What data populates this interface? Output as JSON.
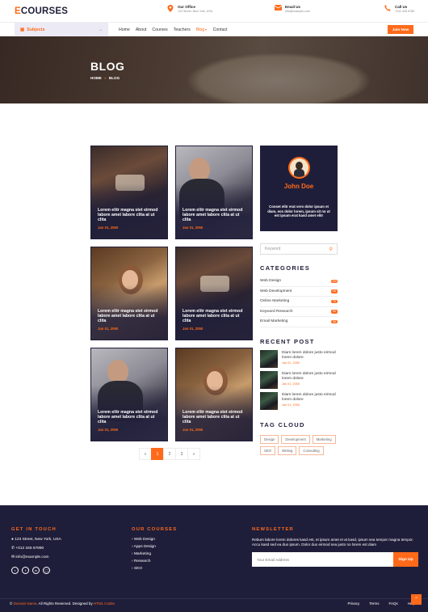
{
  "brand": {
    "e": "E",
    "rest": "COURSES",
    "accent": "#ff6a1a",
    "dark": "#1f1e3a"
  },
  "header": {
    "office": {
      "title": "Our Office",
      "value": "123 Street, New York, USA"
    },
    "email": {
      "title": "Email Us",
      "value": "info@example.com"
    },
    "call": {
      "title": "Call Us",
      "value": "+012 345 6789"
    }
  },
  "nav": {
    "subjects": "Subjects",
    "items": [
      "Home",
      "About",
      "Courses",
      "Teachers",
      "Blog",
      "Contact"
    ],
    "join": "Join Now"
  },
  "hero": {
    "title": "BLOG",
    "crumb_home": "HOME",
    "crumb_sep": "»",
    "crumb_current": "BLOG"
  },
  "posts": [
    {
      "title": "Lorem elitr magna stet eirmod labore amet labore clita at ut clita",
      "date": "Jan 01, 2050"
    },
    {
      "title": "Lorem elitr magna stet eirmod labore amet labore clita at ut clita",
      "date": "Jan 01, 2050"
    },
    {
      "title": "Lorem elitr magna stet eirmod labore amet labore clita at ut clita",
      "date": "Jan 01, 2050"
    },
    {
      "title": "Lorem elitr magna stet eirmod labore amet labore clita at ut clita",
      "date": "Jan 01, 2050"
    },
    {
      "title": "Lorem elitr magna stet eirmod labore amet labore clita at ut clita",
      "date": "Jan 01, 2050"
    },
    {
      "title": "Lorem elitr magna stet eirmod labore amet labore clita at ut clita",
      "date": "Jan 01, 2050"
    }
  ],
  "pagination": {
    "prev": "«",
    "pages": [
      "1",
      "2",
      "3"
    ],
    "next": "»"
  },
  "profile": {
    "name": "John Doe",
    "desc": "Conset elitr erat vero dolor ipsum et diam, eos dolor lorem, ipsum sit no ut est ipsum erat kasd amet elitr"
  },
  "search": {
    "placeholder": "Keyword"
  },
  "categories": {
    "title": "CATEGORIES",
    "items": [
      {
        "label": "Web Design",
        "count": "150"
      },
      {
        "label": "Web Development",
        "count": "131"
      },
      {
        "label": "Online Marketing",
        "count": "78"
      },
      {
        "label": "Keyword Research",
        "count": "56"
      },
      {
        "label": "Email Marketing",
        "count": "98"
      }
    ]
  },
  "recent": {
    "title": "RECENT POST",
    "items": [
      {
        "title": "Diam lorem dolore justo eirmod lorem dolore",
        "date": "Jan 01, 2050"
      },
      {
        "title": "Diam lorem dolore justo eirmod lorem dolore",
        "date": "Jan 01, 2050"
      },
      {
        "title": "Diam lorem dolore justo eirmod lorem dolore",
        "date": "Jan 01, 2050"
      }
    ]
  },
  "tagcloud": {
    "title": "TAG CLOUD",
    "tags": [
      "Design",
      "Development",
      "Marketing",
      "SEO",
      "Writing",
      "Consulting"
    ]
  },
  "footer": {
    "touch": {
      "title": "GET IN TOUCH",
      "address": "123 Street, New York, USA",
      "phone": "+012 345 67890",
      "email": "info@example.com"
    },
    "social": [
      "twitter",
      "facebook",
      "linkedin",
      "instagram"
    ],
    "courses": {
      "title": "OUR COURSES",
      "items": [
        "Web Design",
        "Apps Design",
        "Marketing",
        "Research",
        "SEO"
      ]
    },
    "newsletter": {
      "title": "NEWSLETTER",
      "text": "Rebum labore lorem dolores kasd est, et ipsum amet et at kasd, ipsum sea tempor magna tempor. Accu kasd sed ea duo ipsum. Dolor duo eirmod sea justo no lorem est diam",
      "placeholder": "Your Email Address",
      "button": "Sign Up"
    },
    "copy_pre": "©",
    "copy_domain": "Domain Name",
    "copy_mid": ". All Rights Reserved. Designed by",
    "copy_by": "HTML Codex",
    "links": [
      "Privacy",
      "Terms",
      "FAQs",
      "Help"
    ]
  }
}
